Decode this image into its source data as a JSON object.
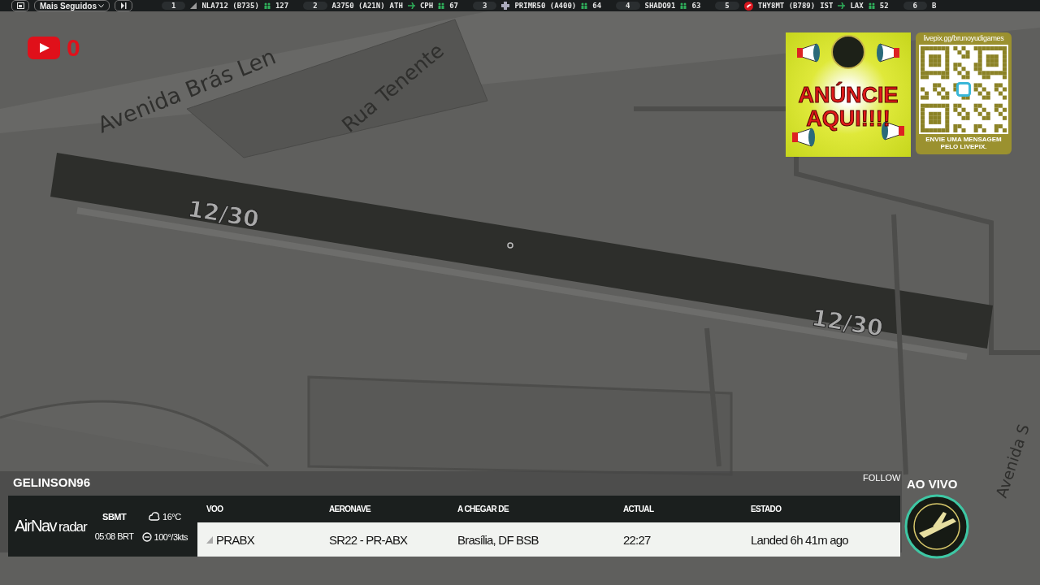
{
  "top_bar": {
    "filter": "Mais Seguidos",
    "ticker": [
      {
        "rank": "1",
        "kind": "aircraft",
        "flight": "NLA712 (B735)",
        "count": "127"
      },
      {
        "rank": "2",
        "kind": "none",
        "flight": "A3750 (A21N)",
        "from": "ATH",
        "to": "CPH",
        "count": "67"
      },
      {
        "rank": "3",
        "kind": "emblem",
        "flight": "PRIMR50 (A400)",
        "count": "64"
      },
      {
        "rank": "4",
        "kind": "none",
        "flight": "SHADO91",
        "count": "63"
      },
      {
        "rank": "5",
        "kind": "airline",
        "flight": "THY8MT (B789)",
        "from": "IST",
        "to": "LAX",
        "count": "52"
      },
      {
        "rank": "6",
        "kind": "none",
        "flight": "B"
      }
    ]
  },
  "map": {
    "streets": [
      "Avenida Brás Len",
      "Rua Tenente",
      "Avenida S"
    ],
    "runway_labels": [
      "12/30",
      "12/30"
    ]
  },
  "youtube": {
    "count": "0"
  },
  "ads": {
    "banner": "ANÚNCIE AQUI!!!!",
    "livepix_url": "livepix.gg/brunoyudigames",
    "livepix_caption": "ENVIE UMA MENSAGEM PELO LIVEPIX."
  },
  "stream": {
    "username": "GELINSON96",
    "follow": "FOLLOW",
    "live": "AO VIVO"
  },
  "airnav": {
    "logo_main": "AirNav",
    "logo_sub": "radar",
    "airport": "SBMT",
    "time": "05:08 BRT",
    "temperature": "16°C",
    "wind": "100°/3kts",
    "columns": [
      "VOO",
      "AERONAVE",
      "A CHEGAR DE",
      "ACTUAL",
      "ESTADO"
    ],
    "row": [
      "PRABX",
      "SR22 - PR-ABX",
      "Brasília, DF BSB",
      "22:27",
      "Landed 6h 41m ago"
    ]
  }
}
